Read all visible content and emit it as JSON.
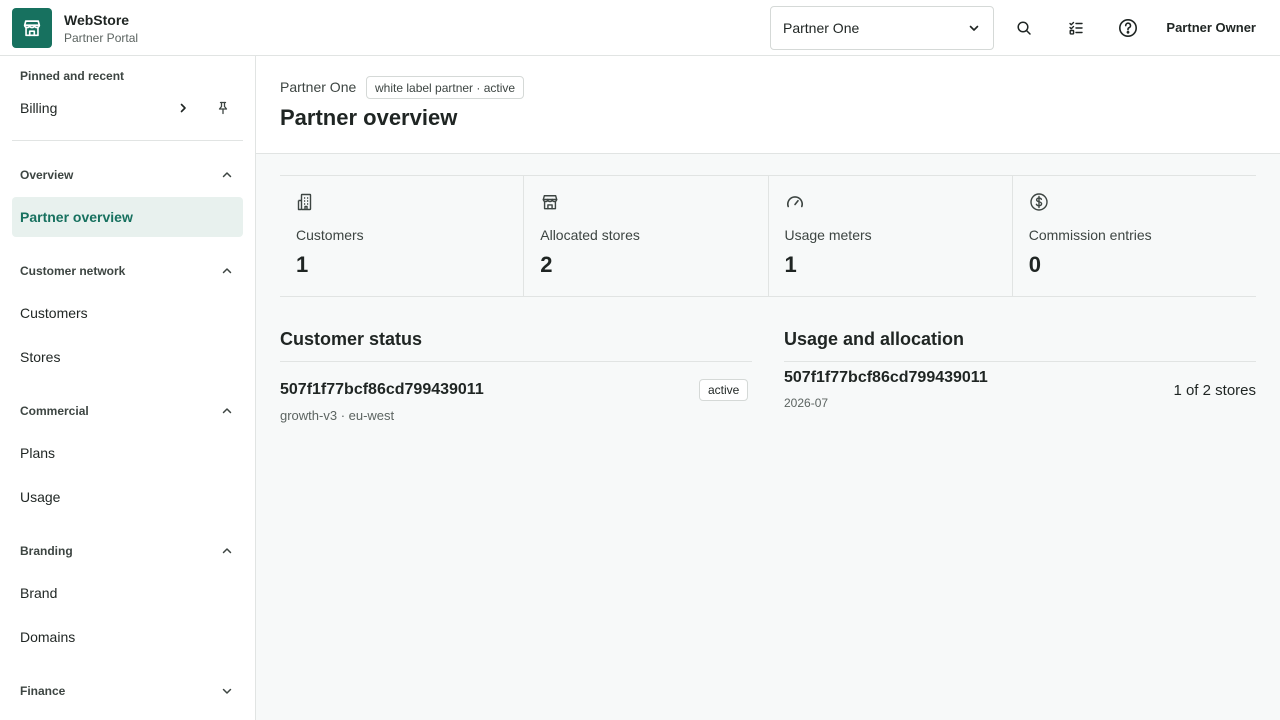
{
  "app": {
    "name": "WebStore",
    "subtitle": "Partner Portal",
    "logo_icon": "storefront-icon",
    "accent": "#17715f"
  },
  "topbar": {
    "partner_select": {
      "value": "Partner One",
      "icon": "chevron-down-icon"
    },
    "icons": [
      "search-icon",
      "checklist-icon",
      "help-icon"
    ],
    "user": "Partner Owner"
  },
  "sidebar": {
    "pinned": {
      "title": "Pinned and recent",
      "items": [
        {
          "label": "Billing",
          "icon": "chevron-right-icon",
          "pin_icon": "pin-icon"
        }
      ]
    },
    "sections": [
      {
        "title": "Overview",
        "expanded": true,
        "items": [
          "Partner overview"
        ],
        "active": "Partner overview"
      },
      {
        "title": "Customer network",
        "expanded": true,
        "items": [
          "Customers",
          "Stores"
        ]
      },
      {
        "title": "Commercial",
        "expanded": true,
        "items": [
          "Plans",
          "Usage"
        ]
      },
      {
        "title": "Branding",
        "expanded": true,
        "items": [
          "Brand",
          "Domains"
        ]
      },
      {
        "title": "Finance",
        "expanded": false,
        "items": []
      }
    ]
  },
  "main": {
    "breadcrumb": "Partner One",
    "tag": "white label partner · active",
    "title": "Partner overview",
    "stats": [
      {
        "icon": "building-icon",
        "label": "Customers",
        "value": "1"
      },
      {
        "icon": "store-icon",
        "label": "Allocated stores",
        "value": "2"
      },
      {
        "icon": "gauge-icon",
        "label": "Usage meters",
        "value": "1"
      },
      {
        "icon": "dollar-circle-icon",
        "label": "Commission entries",
        "value": "0"
      }
    ],
    "customer_status": {
      "title": "Customer status",
      "rows": [
        {
          "id": "507f1f77bcf86cd799439011",
          "meta": "growth-v3 · eu-west",
          "status": "active"
        }
      ]
    },
    "usage_allocation": {
      "title": "Usage and allocation",
      "rows": [
        {
          "id": "507f1f77bcf86cd799439011",
          "period": "2026-07",
          "allocation": "1 of 2 stores"
        }
      ]
    }
  }
}
